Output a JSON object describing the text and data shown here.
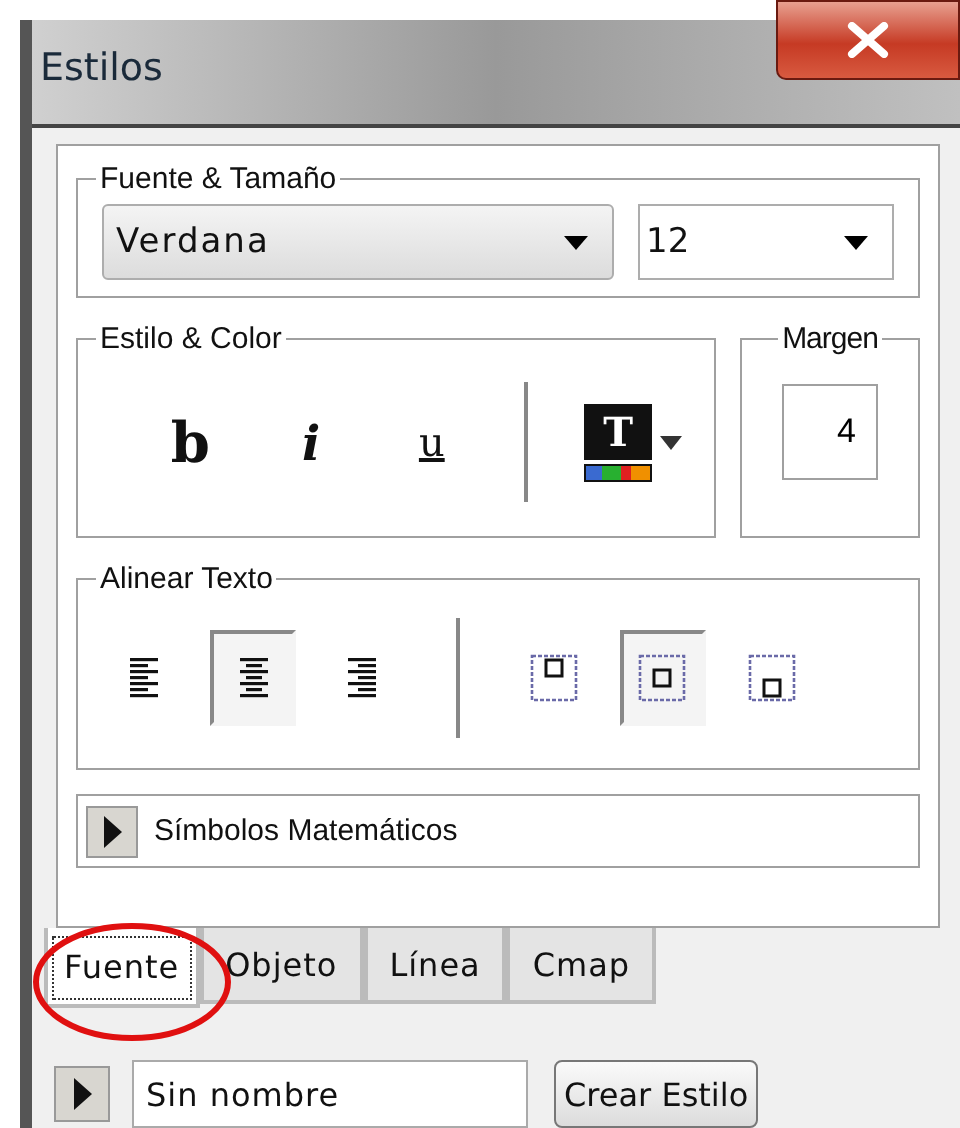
{
  "window": {
    "title": "Estilos"
  },
  "font_group": {
    "legend": "Fuente & Tamaño",
    "font": "Verdana",
    "size": "12"
  },
  "style_group": {
    "legend": "Estilo & Color",
    "buttons": [
      {
        "kind": "bold",
        "label": "b",
        "selected": false
      },
      {
        "kind": "italic",
        "label": "i",
        "selected": false
      },
      {
        "kind": "underline",
        "label": "u",
        "selected": false
      }
    ],
    "color_button": {
      "label": "T"
    }
  },
  "margin_group": {
    "legend": "Margen",
    "value": "4"
  },
  "align_group": {
    "legend": "Alinear Texto",
    "horizontal": [
      {
        "kind": "left",
        "selected": false
      },
      {
        "kind": "center",
        "selected": true
      },
      {
        "kind": "right",
        "selected": false
      }
    ],
    "vertical": [
      {
        "kind": "top",
        "selected": false
      },
      {
        "kind": "middle",
        "selected": true
      },
      {
        "kind": "bottom",
        "selected": false
      }
    ]
  },
  "symbols": {
    "label": "Símbolos Matemáticos",
    "expanded": false
  },
  "tabs": [
    {
      "label": "Fuente",
      "selected": true
    },
    {
      "label": "Objeto",
      "selected": false
    },
    {
      "label": "Línea",
      "selected": false
    },
    {
      "label": "Cmap",
      "selected": false
    }
  ],
  "footer": {
    "expanded": false,
    "name": "Sin nombre",
    "button": "Crear Estilo"
  }
}
